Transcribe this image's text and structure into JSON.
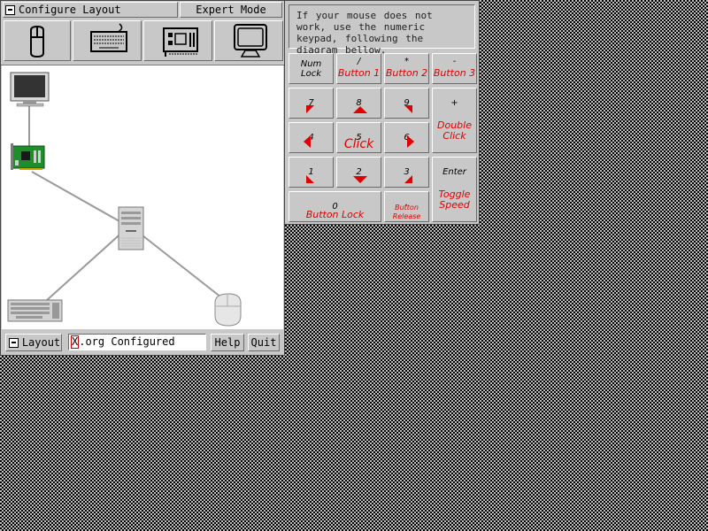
{
  "main_window": {
    "title": "Configure Layout",
    "mode": "Expert Mode",
    "toolbar": [
      "mouse-icon",
      "keyboard-icon",
      "video-card-icon",
      "monitor-icon"
    ],
    "canvas_devices": [
      "monitor",
      "video-card",
      "computer",
      "keyboard",
      "mouse"
    ],
    "bottom": {
      "layout_label": "Layout",
      "status_first": "X",
      "status_rest": ".org Configured",
      "help_label": "Help",
      "quit_label": "Quit"
    }
  },
  "keypad": {
    "instructions": "If your mouse does not work, use the numeric keypad, following the diagram bellow.",
    "keys": [
      {
        "id": "numlock",
        "key": "Num Lock",
        "func": ""
      },
      {
        "id": "slash",
        "key": "/",
        "func": "Button 1"
      },
      {
        "id": "star",
        "key": "*",
        "func": "Button 2"
      },
      {
        "id": "minus",
        "key": "-",
        "func": "Button 3"
      },
      {
        "id": "k7",
        "key": "7",
        "func": ""
      },
      {
        "id": "k8",
        "key": "8",
        "func": ""
      },
      {
        "id": "k9",
        "key": "9",
        "func": ""
      },
      {
        "id": "plus",
        "key": "+",
        "func": "Double Click"
      },
      {
        "id": "k4",
        "key": "4",
        "func": ""
      },
      {
        "id": "k5",
        "key": "5",
        "func": "Click"
      },
      {
        "id": "k6",
        "key": "6",
        "func": ""
      },
      {
        "id": "k1",
        "key": "1",
        "func": ""
      },
      {
        "id": "k2",
        "key": "2",
        "func": ""
      },
      {
        "id": "k3",
        "key": "3",
        "func": ""
      },
      {
        "id": "enter",
        "key": "Enter",
        "func": "Toggle Speed"
      },
      {
        "id": "k0",
        "key": "0",
        "func": "Button Lock"
      },
      {
        "id": "dot",
        "key": ".",
        "func": "Button Release"
      }
    ]
  },
  "colors": {
    "accent": "#e00000",
    "panel": "#c8c8c8",
    "canvas": "#ffffff"
  }
}
